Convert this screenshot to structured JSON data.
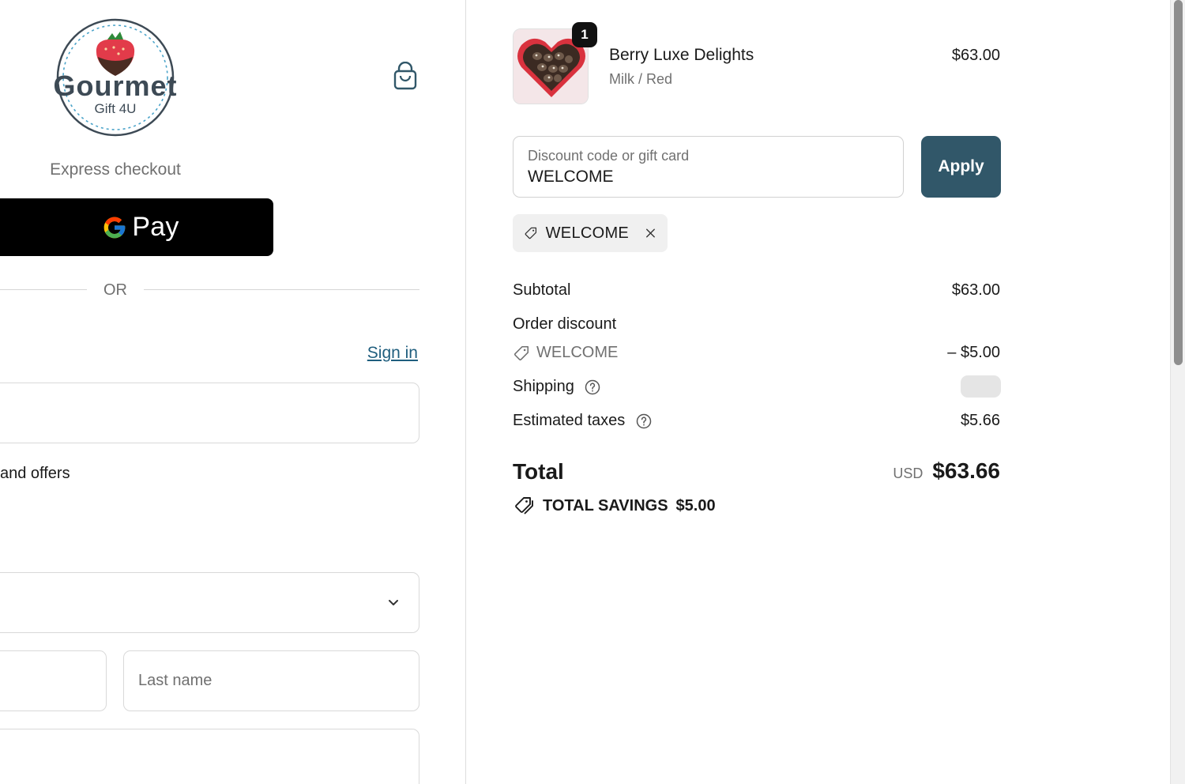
{
  "brand": {
    "logo_main": "Gourmet",
    "logo_sub": "Gift 4U",
    "logo_icon": "strawberry-icon"
  },
  "header": {
    "cart_icon": "shopping-bag-icon"
  },
  "express": {
    "label": "Express checkout",
    "gpay_label": "Pay",
    "gpay_icon": "google-g-icon"
  },
  "divider": {
    "or_text": "OR"
  },
  "contact": {
    "sign_in": "Sign in",
    "offers_text": "and offers"
  },
  "delivery": {
    "last_name_placeholder": "Last name"
  },
  "order": {
    "item": {
      "name": "Berry Luxe Delights",
      "variant": "Milk / Red",
      "price": "$63.00",
      "quantity": "1"
    },
    "discount": {
      "label": "Discount code or gift card",
      "value": "WELCOME",
      "apply_label": "Apply",
      "applied_code": "WELCOME"
    },
    "summary": {
      "subtotal_label": "Subtotal",
      "subtotal_value": "$63.00",
      "order_discount_label": "Order discount",
      "discount_code": "WELCOME",
      "discount_value": "– $5.00",
      "shipping_label": "Shipping",
      "taxes_label": "Estimated taxes",
      "taxes_value": "$5.66",
      "total_label": "Total",
      "total_currency": "USD",
      "total_value": "$63.66",
      "savings_label": "TOTAL SAVINGS",
      "savings_value": "$5.00"
    }
  },
  "colors": {
    "accent": "#315769",
    "link": "#1f5e7e",
    "muted": "#707070",
    "border": "#d9d9d9"
  }
}
